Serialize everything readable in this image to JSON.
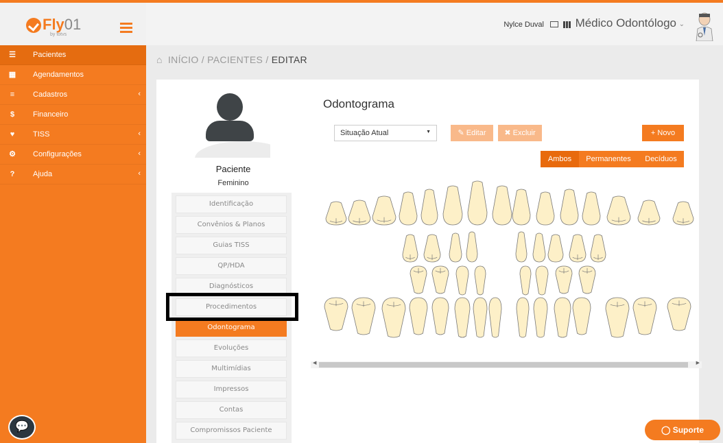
{
  "brand": {
    "name": "Fly",
    "suffix": "01",
    "sub": "by totvs"
  },
  "sidebar": {
    "items": [
      {
        "label": "Pacientes",
        "icon": "users-icon",
        "glyph": "☰",
        "chevron": ""
      },
      {
        "label": "Agendamentos",
        "icon": "calendar-icon",
        "glyph": "▦",
        "chevron": ""
      },
      {
        "label": "Cadastros",
        "icon": "list-icon",
        "glyph": "≡",
        "chevron": "‹"
      },
      {
        "label": "Financeiro",
        "icon": "dollar-icon",
        "glyph": "$",
        "chevron": ""
      },
      {
        "label": "TISS",
        "icon": "heart-icon",
        "glyph": "♥",
        "chevron": "‹"
      },
      {
        "label": "Configurações",
        "icon": "gear-icon",
        "glyph": "⚙",
        "chevron": "‹"
      },
      {
        "label": "Ajuda",
        "icon": "question-icon",
        "glyph": "?",
        "chevron": "‹"
      }
    ]
  },
  "topbar": {
    "user": "Nylce Duval",
    "role": "Médico Odontólogo",
    "role_chevron": "⌄"
  },
  "breadcrumb": {
    "home": "INÍCIO",
    "sep1": "/",
    "section": "PACIENTES",
    "sep2": "/",
    "current": "EDITAR"
  },
  "patient": {
    "name": "Paciente",
    "gender": "Feminino"
  },
  "nav": {
    "items": [
      "Identificação",
      "Convênios & Planos",
      "Guias TISS",
      "QP/HDA",
      "Diagnósticos",
      "Procedimentos",
      "Odontograma",
      "Evoluções",
      "Multimídias",
      "Impressos",
      "Contas",
      "Compromissos Paciente"
    ],
    "active": "Odontograma"
  },
  "odontograma": {
    "title": "Odontograma",
    "select_value": "Situação Atual",
    "editar": "Editar",
    "excluir": "Excluir",
    "novo": "Novo",
    "segments": {
      "ambos": "Ambos",
      "permanentes": "Permanentes",
      "deciduos": "Decíduos"
    },
    "active_segment": "Ambos"
  },
  "support": {
    "label": "Suporte"
  },
  "colors": {
    "accent": "#f47b20",
    "tooth": "#fdf0c8",
    "tooth_outline": "#777777"
  }
}
